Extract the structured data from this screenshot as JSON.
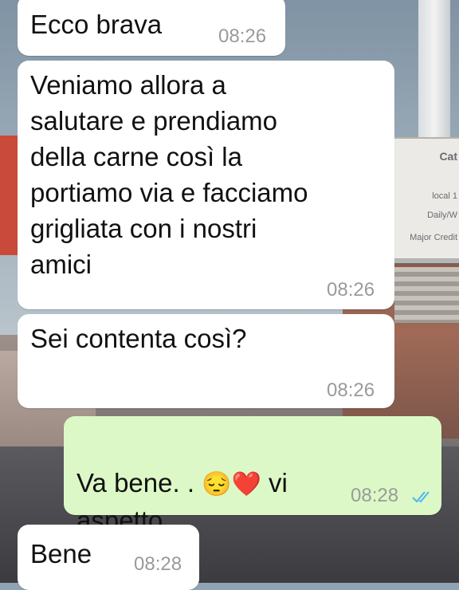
{
  "messages": [
    {
      "direction": "in",
      "text": "Ecco brava",
      "time": "08:26"
    },
    {
      "direction": "in",
      "text": "Veniamo allora a\nsalutare e prendiamo\ndella carne così la\nportiamo via e facciamo\ngrigliata con i nostri\namici",
      "time": "08:26"
    },
    {
      "direction": "in",
      "text": "Sei contenta così?",
      "time": "08:26"
    },
    {
      "direction": "out",
      "text_before": "Va bene. . ",
      "emojis": "😔❤️",
      "text_after": " vi\naspetto",
      "time": "08:28",
      "status": "read-double-check-icon"
    },
    {
      "direction": "in",
      "text": "Bene",
      "time": "08:28"
    }
  ],
  "background_sign_texts": [
    "Cat",
    "local 1",
    "Daily/W",
    "Major Credit"
  ],
  "colors": {
    "incoming_bubble": "#ffffff",
    "outgoing_bubble": "#dcf8c6",
    "read_tick": "#4fb6ec",
    "timestamp": "#9a9a9a"
  }
}
